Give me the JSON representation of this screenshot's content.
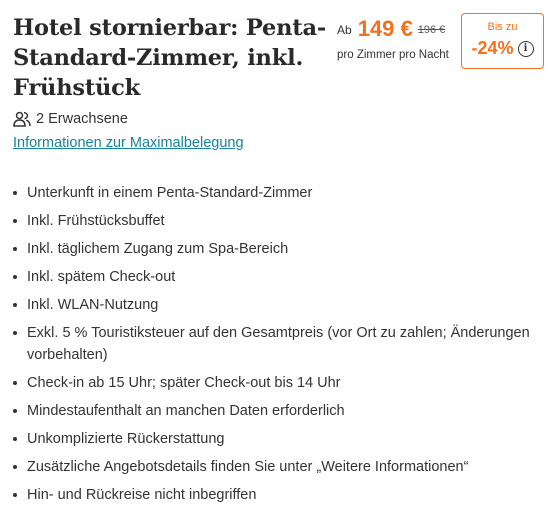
{
  "deal": {
    "title": "Hotel stornierbar: Penta-Standard-Zimmer, inkl. Frühstück"
  },
  "price": {
    "prefix": "Ab",
    "current": "149 €",
    "original": "196 €",
    "unit": "pro Zimmer pro Nacht"
  },
  "discount": {
    "label": "Bis zu",
    "value": "-24%",
    "info_icon": "info-icon"
  },
  "guests": {
    "icon": "users-icon",
    "text": "2 Erwachsene"
  },
  "occupancy_link": "Informationen zur Maximalbelegung",
  "features": [
    "Unterkunft in einem Penta-Standard-Zimmer",
    "Inkl. Frühstücksbuffet",
    "Inkl. täglichem Zugang zum Spa-Bereich",
    "Inkl. spätem Check-out",
    "Inkl. WLAN-Nutzung",
    "Exkl. 5 % Touristiksteuer auf den Gesamtpreis (vor Ort zu zahlen; Änderungen vorbehalten)",
    "Check-in ab 15 Uhr; später Check-out bis 14 Uhr",
    "Mindestaufenthalt an manchen Daten erforderlich",
    "Unkomplizierte Rückerstattung",
    "Zusätzliche Angebotsdetails finden Sie unter „Weitere Informationen“",
    "Hin- und Rückreise nicht inbegriffen"
  ],
  "colors": {
    "accent": "#f2711c",
    "link": "#16849a",
    "text": "#333333"
  }
}
